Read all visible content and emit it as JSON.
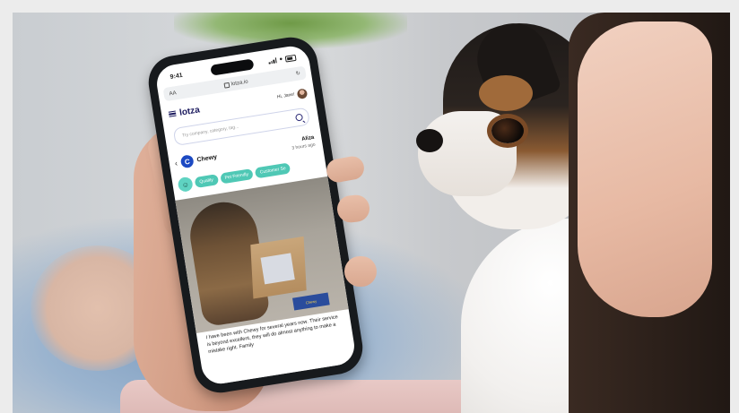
{
  "status_bar": {
    "time": "9:41"
  },
  "browser": {
    "text_size": "AA",
    "url": "lotza.io",
    "reload_icon": "reload-icon"
  },
  "app": {
    "logo": "lotza",
    "greeting": "Hi, Jane!",
    "search_placeholder": "Try company, category, tag..."
  },
  "post": {
    "company": "Chewy",
    "company_logo_letter": "C",
    "author": "Aliza",
    "time_ago": "3 hours ago",
    "tags": [
      "Quality",
      "Pet Friendly",
      "Customer Se"
    ],
    "image_label": "Chewy",
    "text": "I have been with Chewy for several years now. Their service is beyond excellent, they will do almost anything to make a mistake right. Family"
  },
  "colors": {
    "brand": "#1b1a5e",
    "tag": "#4fc8b5",
    "chewy_blue": "#1c49c2"
  }
}
